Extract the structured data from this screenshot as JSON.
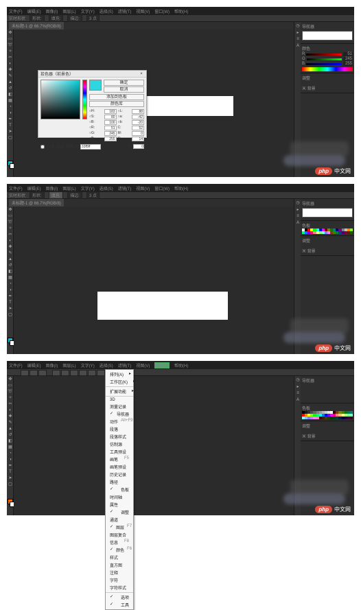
{
  "menu": [
    "文件(F)",
    "编辑(E)",
    "图像(I)",
    "图层(L)",
    "文字(Y)",
    "选择(S)",
    "滤镜(T)",
    "视图(V)",
    "窗口(W)",
    "帮助(H)"
  ],
  "tab": {
    "doc": "未标题-1 @ 66.7%(RGB/8)",
    "zoom": "66.7%"
  },
  "options": {
    "shape_label": "形状:",
    "fill_label": "填充:",
    "stroke_label": "描边:",
    "stroke_pt": "3 点",
    "live": "实时形状"
  },
  "color_picker": {
    "title": "拾色器（前景色）",
    "ok": "确定",
    "cancel": "取消",
    "add_swatch": "添加到色板",
    "color_lib": "颜色库",
    "only_web": "只有 Web 颜色",
    "H": "183",
    "S": "80",
    "Bv": "100",
    "R": "51",
    "G": "245",
    "B": "255",
    "L": "88",
    "a": "-42",
    "bl": "-20",
    "C": "52",
    "M": "0",
    "Y": "14",
    "K": "0",
    "hex_label": "#",
    "hex": "33f5ff"
  },
  "right": {
    "nav_tab": "导航器",
    "color_tab": "颜色",
    "swatch_tab": "色板",
    "adjust_tab": "调整",
    "layers_tab": "图层",
    "bg_layer": "▣ 背景",
    "R": "R",
    "G": "G",
    "B": "B",
    "rv": "51",
    "gv": "245",
    "bv": "255"
  },
  "window_menu": {
    "items": [
      {
        "t": "排列(A)",
        "sub": true
      },
      {
        "t": "工作区(K)",
        "sub": true
      },
      {
        "sep": true
      },
      {
        "t": "扩展功能",
        "sub": true
      },
      {
        "sep": true
      },
      {
        "t": "3D"
      },
      {
        "t": "测量记录"
      },
      {
        "t": "导航器",
        "check": true
      },
      {
        "t": "动作",
        "sc": "Alt+F9"
      },
      {
        "t": "段落"
      },
      {
        "t": "段落样式"
      },
      {
        "t": "仿制源"
      },
      {
        "t": "工具预设"
      },
      {
        "t": "画笔",
        "sc": "F5"
      },
      {
        "t": "画笔预设"
      },
      {
        "t": "历史记录"
      },
      {
        "t": "路径"
      },
      {
        "t": "色板",
        "check": true
      },
      {
        "t": "时间轴"
      },
      {
        "t": "属性"
      },
      {
        "t": "调整",
        "check": true
      },
      {
        "t": "通道"
      },
      {
        "t": "图层",
        "sc": "F7",
        "check": true
      },
      {
        "t": "图层复合"
      },
      {
        "t": "信息",
        "sc": "F8"
      },
      {
        "t": "颜色",
        "sc": "F6",
        "check": true
      },
      {
        "t": "样式"
      },
      {
        "t": "直方图"
      },
      {
        "t": "注释"
      },
      {
        "t": "字符"
      },
      {
        "t": "字符样式"
      },
      {
        "sep": true
      },
      {
        "t": "选项",
        "check": true
      },
      {
        "t": "工具",
        "check": true
      }
    ]
  },
  "watermark": {
    "logo": "php",
    "text": "中文网"
  },
  "swatch_colors": [
    "#ffffff",
    "#000000",
    "#ff0000",
    "#ffff00",
    "#00ff00",
    "#00ffff",
    "#0000ff",
    "#ff00ff",
    "#800000",
    "#808000",
    "#008000",
    "#008080",
    "#000080",
    "#800080",
    "#808080",
    "#c0c0c0",
    "#ff8000",
    "#80ff00",
    "#00ff80",
    "#0080ff",
    "#8000ff",
    "#ff0080",
    "#ff8080",
    "#ffff80",
    "#80ff80",
    "#80ffff",
    "#8080ff",
    "#ff80ff",
    "#804000",
    "#408000",
    "#008040",
    "#004080",
    "#400080",
    "#800040",
    "#552200",
    "#225500"
  ],
  "swatch_colors2": [
    "#000000",
    "#1a1a1a",
    "#333333",
    "#4d4d4d",
    "#666666",
    "#808080",
    "#999999",
    "#b3b3b3",
    "#cccccc",
    "#e6e6e6",
    "#ffffff",
    "#400000",
    "#804000",
    "#808000",
    "#408000",
    "#008000",
    "#008040",
    "#008080",
    "#ff0000",
    "#ff8000",
    "#ffff00",
    "#80ff00",
    "#00ff00",
    "#00ff80",
    "#00ffff",
    "#0080ff",
    "#0000ff",
    "#8000ff",
    "#ff00ff",
    "#ff0080",
    "#ff8080",
    "#ffc080",
    "#ffff80",
    "#c0ff80",
    "#80ff80",
    "#80ffc0",
    "#80ffff",
    "#80c0ff",
    "#8080ff",
    "#c080ff",
    "#ff80ff",
    "#ff80c0",
    "#400000",
    "#402000",
    "#404000",
    "#204000",
    "#004000",
    "#004020",
    "#004040",
    "#002040",
    "#000040",
    "#200040",
    "#400040",
    "#400020"
  ]
}
